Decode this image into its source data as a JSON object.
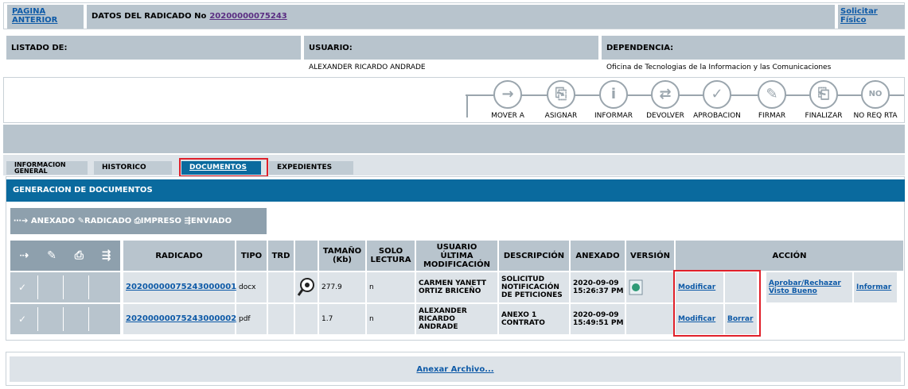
{
  "top": {
    "prev_label_1": "PAGINA",
    "prev_label_2": "ANTERIOR",
    "datos_label": "DATOS DEL RADICADO No",
    "radicado_number": "20200000075243",
    "solicitar_1": "Solicitar",
    "solicitar_2": "Físico"
  },
  "info": {
    "listado_label": "LISTADO DE:",
    "usuario_label": "USUARIO:",
    "dependencia_label": "DEPENDENCIA:",
    "usuario_value": "ALEXANDER RICARDO ANDRADE",
    "dependencia_value": "Oficina de Tecnologias de la Informacion y las Comunicaciones"
  },
  "actions": [
    {
      "label": "MOVER A",
      "icon": "arrow-right-icon",
      "glyph": "→"
    },
    {
      "label": "ASIGNAR",
      "icon": "assign-icon",
      "glyph": "⎘"
    },
    {
      "label": "INFORMAR",
      "icon": "info-icon",
      "glyph": "i"
    },
    {
      "label": "DEVOLVER",
      "icon": "return-icon",
      "glyph": "⇄"
    },
    {
      "label": "APROBACION",
      "icon": "check-icon",
      "glyph": "✓"
    },
    {
      "label": "FIRMAR",
      "icon": "sign-icon",
      "glyph": "✎"
    },
    {
      "label": "FINALIZAR",
      "icon": "finalize-icon",
      "glyph": "⎗"
    },
    {
      "label": "NO REQ RTA",
      "icon": "no-response-icon",
      "glyph": "NO"
    }
  ],
  "tabs": [
    {
      "label_1": "INFORMACION",
      "label_2": "GENERAL"
    },
    {
      "label": "HISTORICO"
    },
    {
      "label": "DOCUMENTOS"
    },
    {
      "label": "EXPEDIENTES"
    }
  ],
  "section_title": "GENERACION DE DOCUMENTOS",
  "legend": {
    "anexado": "ANEXADO",
    "radicado": "RADICADO",
    "impreso": "IMPRESO",
    "enviado": "ENVIADO"
  },
  "columns": {
    "radicado": "RADICADO",
    "tipo": "TIPO",
    "trd": "TRD",
    "tamano_1": "TAMAÑO",
    "tamano_2": "(Kb)",
    "solo_1": "SOLO",
    "solo_2": "LECTURA",
    "usuario_1": "USUARIO",
    "usuario_2": "ÚLTIMA",
    "usuario_3": "MODIFICACIÓN",
    "descripcion": "DESCRIPCIÓN",
    "anexado": "ANEXADO",
    "version": "VERSIÓN",
    "accion": "ACCIÓN"
  },
  "rows": [
    {
      "radicado": "20200000075243000001",
      "tipo": "docx",
      "tamano": "277.9",
      "solo": "n",
      "usuario_1": "CARMEN YANETT",
      "usuario_2": "ORTIZ BRICEÑO",
      "desc_1": "SOLICITUD",
      "desc_2": "NOTIFICACIÓN",
      "desc_3": "DE PETICIONES",
      "fecha_1": "2020-09-09",
      "fecha_2": "15:26:37 PM",
      "modificar": "Modificar",
      "aprobar_1": "Aprobar/Rechazar",
      "aprobar_2": "Visto Bueno",
      "informar": "Informar"
    },
    {
      "radicado": "20200000075243000002",
      "tipo": "pdf",
      "tamano": "1.7",
      "solo": "n",
      "usuario_1": "ALEXANDER",
      "usuario_2": "RICARDO",
      "usuario_3": "ANDRADE",
      "desc_1": "ANEXO 1",
      "desc_2": "CONTRATO",
      "fecha_1": "2020-09-09",
      "fecha_2": "15:49:51 PM",
      "modificar": "Modificar",
      "borrar": "Borrar"
    }
  ],
  "anexar": "Anexar Archivo...",
  "colors": {
    "header_blue": "#0a6a9e",
    "highlight_red": "#e0202a",
    "gray": "#b8c4cd",
    "light_gray": "#dde3e8"
  }
}
